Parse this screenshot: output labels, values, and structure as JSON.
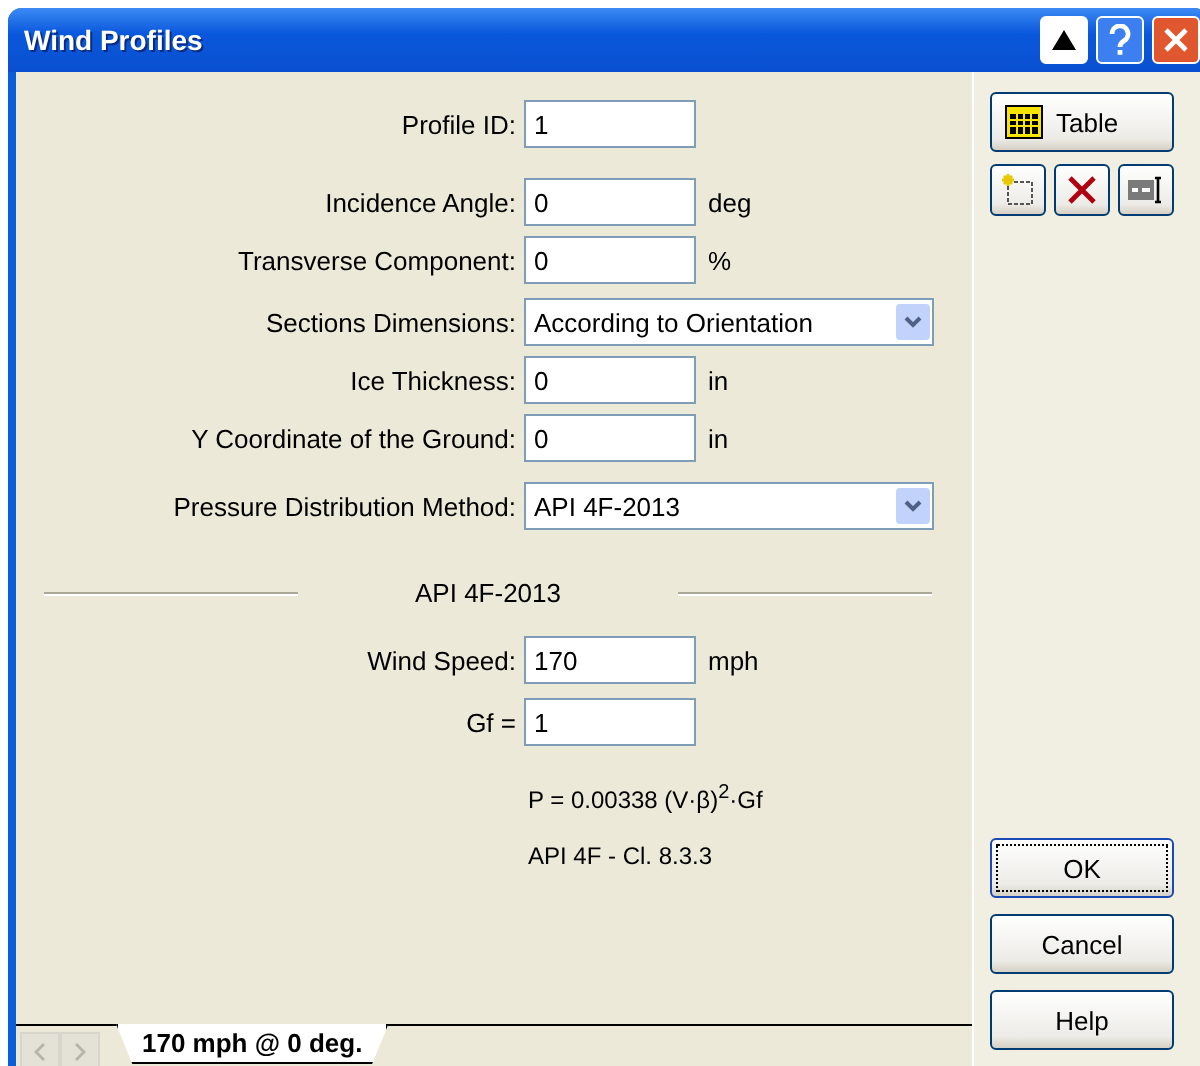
{
  "window": {
    "title": "Wind Profiles"
  },
  "fields": [
    {
      "label": "Profile ID:",
      "kind": "text",
      "value": "1"
    },
    {
      "label": "Incidence Angle:",
      "kind": "text",
      "value": "0",
      "unit": "deg"
    },
    {
      "label": "Transverse Component:",
      "kind": "text",
      "value": "0",
      "unit": "%"
    },
    {
      "label": "Sections Dimensions:",
      "kind": "select",
      "value": "According to Orientation"
    },
    {
      "label": "Ice Thickness:",
      "kind": "text",
      "value": "0",
      "unit": "in"
    },
    {
      "label": "Y Coordinate of the Ground:",
      "kind": "text",
      "value": "0",
      "unit": "in"
    },
    {
      "label": "Pressure Distribution Method:",
      "kind": "select",
      "value": "API 4F-2013"
    }
  ],
  "section": {
    "title": "API 4F-2013",
    "fields": [
      {
        "label": "Wind Speed:",
        "kind": "text",
        "value": "170",
        "unit": "mph"
      },
      {
        "label": "Gf =",
        "kind": "text",
        "value": "1"
      }
    ],
    "formula": "P = 0.00338 (V·β)$^{2}$·Gf",
    "reference": "API 4F - Cl. 8.3.3"
  },
  "tabs": [
    {
      "label": "170 mph @ 0 deg.",
      "selected": true
    }
  ],
  "side_buttons": {
    "table": "Table",
    "dialog": [
      "OK",
      "Cancel",
      "Help"
    ]
  }
}
